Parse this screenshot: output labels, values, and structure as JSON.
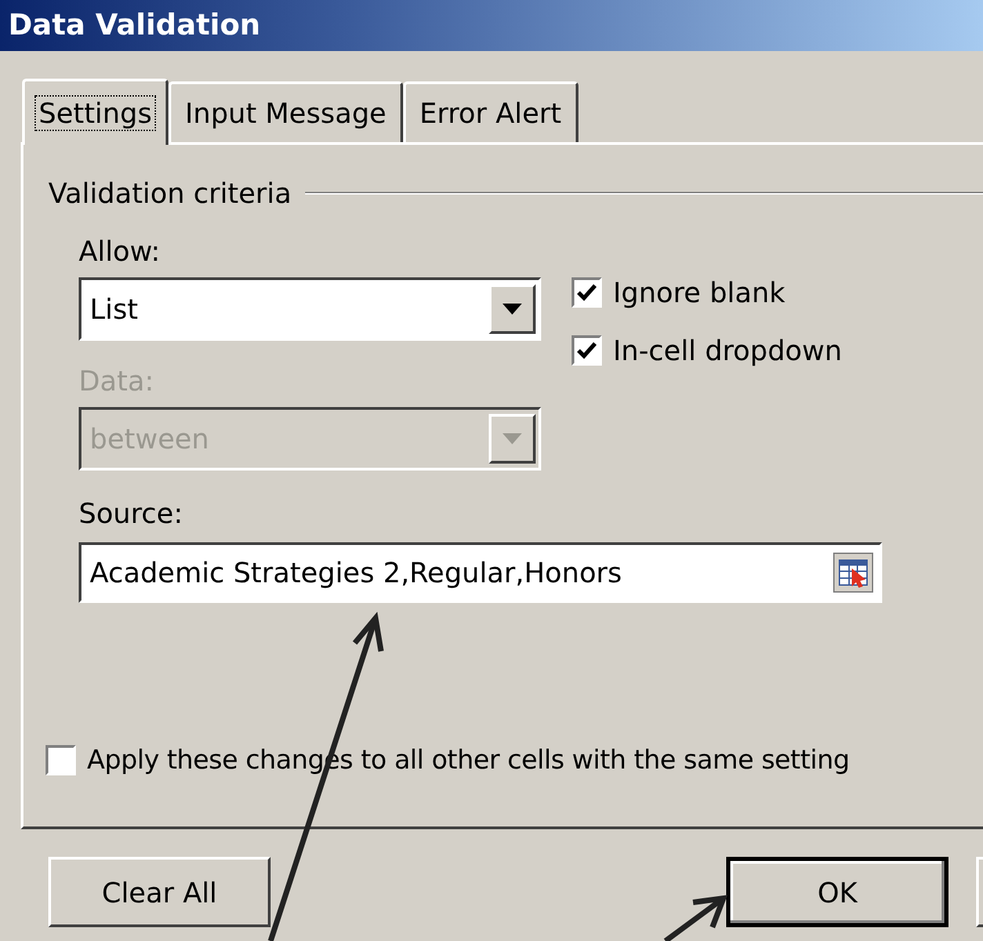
{
  "window": {
    "title": "Data Validation"
  },
  "tabs": [
    {
      "label": "Settings",
      "selected": true
    },
    {
      "label": "Input Message",
      "selected": false
    },
    {
      "label": "Error Alert",
      "selected": false
    }
  ],
  "group": {
    "title": "Validation criteria"
  },
  "allow": {
    "label": "Allow:",
    "value": "List",
    "disabled": false
  },
  "data": {
    "label": "Data:",
    "value": "between",
    "disabled": true
  },
  "options": [
    {
      "label": "Ignore blank",
      "checked": true
    },
    {
      "label": "In-cell dropdown",
      "checked": true
    }
  ],
  "source": {
    "label": "Source:",
    "value": "Academic Strategies 2,Regular,Honors"
  },
  "apply_all": {
    "label": "Apply these changes to all other cells with the same setting",
    "checked": false
  },
  "buttons": [
    {
      "label": "Clear All",
      "default": false
    },
    {
      "label": "OK",
      "default": true
    }
  ]
}
